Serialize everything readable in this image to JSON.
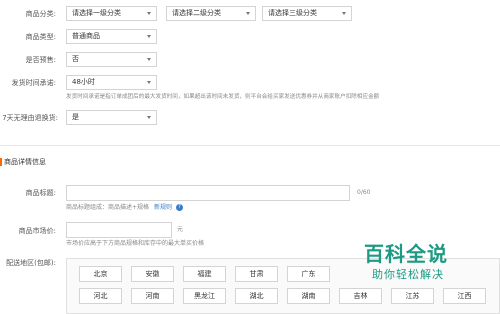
{
  "form": {
    "category": {
      "label": "商品分类:",
      "level1": "请选择一级分类",
      "level2": "请选择二级分类",
      "level3": "请选择三级分类"
    },
    "product_type": {
      "label": "商品类型:",
      "value": "普通商品"
    },
    "presale": {
      "label": "是否预售:",
      "value": "否"
    },
    "ship_promise": {
      "label": "发货时间承诺:",
      "value": "48小时",
      "hint": "发货时间承诺是指订单成团后的最大发货时间，如果超出该时间未发货，则平台会给买家发送优惠券并从商家账户扣除相应金额"
    },
    "return_policy": {
      "label": "7天无理由退换货:",
      "value": "是"
    }
  },
  "details": {
    "section_title": "商品详情信息",
    "title_field": {
      "label": "商品标题:",
      "value": "",
      "counter": "0/60",
      "hint": "商品标题组成：商品描述+规格",
      "rule_link": "新规则"
    },
    "market_price": {
      "label": "商品市场价:",
      "value": "",
      "unit": "元",
      "hint": "市场价应高于下方商品规格和库存中的最大单买价格"
    },
    "shipping": {
      "label": "配送地区(包邮):",
      "row1": [
        "北京",
        "安徽",
        "福建",
        "甘肃",
        "广东"
      ],
      "row2": [
        "河北",
        "河南",
        "黑龙江",
        "湖北",
        "湖南",
        "吉林",
        "江苏",
        "江西"
      ]
    }
  },
  "watermark": {
    "title": "百科全说",
    "subtitle": "助你轻松解决"
  },
  "colors": {
    "accent": "#ff6a00",
    "link": "#3b7cc9",
    "watermark": "#1c9a84"
  }
}
